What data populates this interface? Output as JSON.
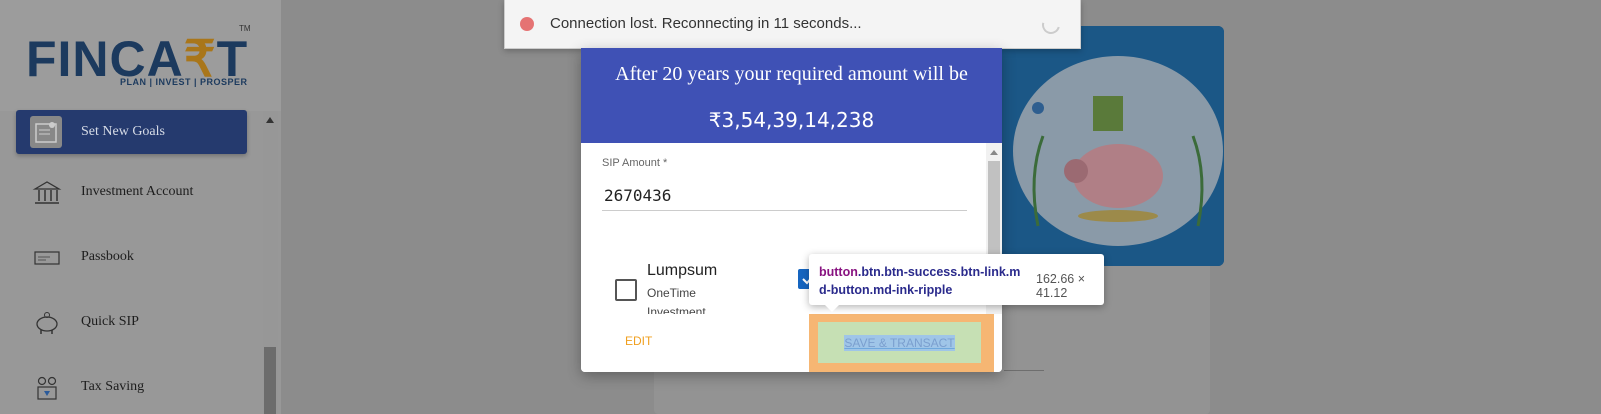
{
  "brand": {
    "logo_pre": "FINCA",
    "logo_r": "₹",
    "logo_post": "T",
    "tm": "TM",
    "tagline": "PLAN | INVEST | PROSPER"
  },
  "sidebar": {
    "items": [
      {
        "label": "Set New Goals",
        "icon": "goals-icon",
        "active": true
      },
      {
        "label": "Investment Account",
        "icon": "bank-icon",
        "active": false
      },
      {
        "label": "Passbook",
        "icon": "passbook-icon",
        "active": false
      },
      {
        "label": "Quick SIP",
        "icon": "piggy-bank-icon",
        "active": false
      },
      {
        "label": "Tax Saving",
        "icon": "tax-saving-icon",
        "active": false
      }
    ]
  },
  "toast": {
    "text": "Connection lost. Reconnecting in 11 seconds..."
  },
  "modal": {
    "title": "After 20 years your required amount will be",
    "amount": "₹3,54,39,14,238",
    "sip_label": "SIP Amount *",
    "sip_value": "2670436",
    "lumpsum_title": "Lumpsum",
    "lumpsum_sub": "OneTime Investment",
    "lumpsum_checked": false,
    "edit_label": "EDIT",
    "save_label": "SAVE & TRANSACT"
  },
  "devtools_tooltip": {
    "tag": "button",
    "classes": ".btn.btn-success.btn-link.md-button.md-ink-ripple",
    "dimensions": "162.66 × 41.12"
  },
  "colors": {
    "header": "#3f51b5",
    "nav_active": "#253a6e",
    "edit": "#f0a020",
    "toast_dot": "#e57373"
  }
}
